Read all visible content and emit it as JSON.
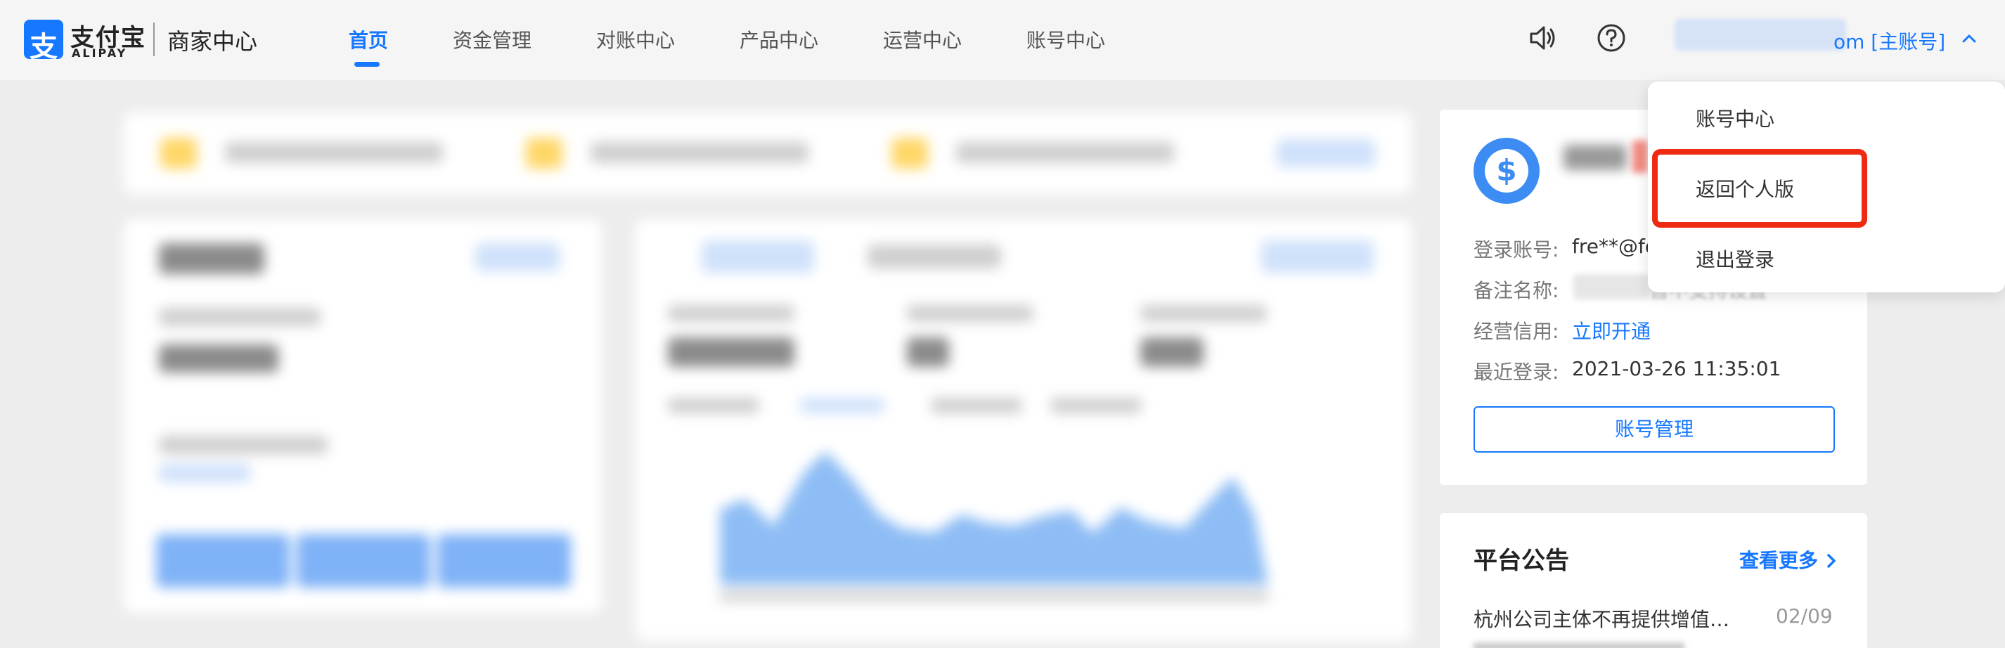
{
  "brand": {
    "logo_glyph": "支",
    "name_cn": "支付宝",
    "name_en": "ALIPAY",
    "section": "商家中心",
    "color": "#1677ff"
  },
  "nav": {
    "items": [
      {
        "label": "首页",
        "active": true
      },
      {
        "label": "资金管理",
        "active": false
      },
      {
        "label": "对账中心",
        "active": false
      },
      {
        "label": "产品中心",
        "active": false
      },
      {
        "label": "运营中心",
        "active": false
      },
      {
        "label": "账号中心",
        "active": false
      }
    ]
  },
  "header": {
    "icons": [
      "speaker-icon",
      "help-icon"
    ],
    "account_suffix": "om [主账号]",
    "caret_icon": "chevron-up-icon"
  },
  "dropdown": {
    "items": [
      "账号中心",
      "返回个人版",
      "退出登录"
    ],
    "highlighted_index": 1,
    "highlight_color": "#ee2a13"
  },
  "account_card": {
    "avatar_icon": "dollar-coin-icon",
    "login_label": "登录账号:",
    "login_value": "fre**@fo",
    "remark_label": "备注名称:",
    "remark_tail": "暂不支持设置",
    "credit_label": "经营信用:",
    "credit_link": "立即开通",
    "last_login_label": "最近登录:",
    "last_login_value": "2021-03-26 11:35:01",
    "manage_button": "账号管理"
  },
  "announcements": {
    "title": "平台公告",
    "more_link": "查看更多",
    "more_icon": "chevron-right-icon",
    "items": [
      {
        "text": "杭州公司主体不再提供增值税...",
        "date": "02/09"
      }
    ]
  }
}
